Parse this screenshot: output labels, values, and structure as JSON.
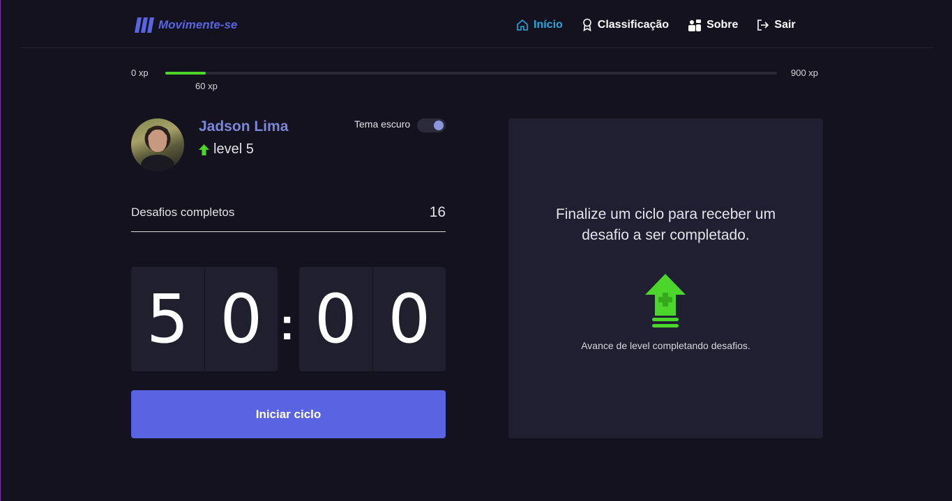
{
  "header": {
    "logo_text": "Movimente-se",
    "nav": [
      {
        "label": "Início",
        "icon": "home-icon",
        "active": true
      },
      {
        "label": "Classificação",
        "icon": "award-icon",
        "active": false
      },
      {
        "label": "Sobre",
        "icon": "people-icon",
        "active": false
      },
      {
        "label": "Sair",
        "icon": "logout-icon",
        "active": false
      }
    ]
  },
  "experience": {
    "min_label": "0 xp",
    "max_label": "900 xp",
    "current_label": "60 xp",
    "current": 60,
    "max": 900
  },
  "profile": {
    "name": "Jadson Lima",
    "level_label": "level 5",
    "theme_label": "Tema escuro",
    "dark_theme_on": true
  },
  "challenges": {
    "label": "Desafios completos",
    "count": "16"
  },
  "countdown": {
    "minute_left": "5",
    "minute_right": "0",
    "separator": ":",
    "second_left": "0",
    "second_right": "0"
  },
  "start_button_label": "Iniciar ciclo",
  "challenge_panel": {
    "title": "Finalize um ciclo para receber um desafio a ser completado.",
    "description": "Avance de level completando desafios.",
    "icon": "level-up-icon"
  },
  "colors": {
    "background": "#13121e",
    "accent": "#5965e0",
    "active_nav": "#2aa9e0",
    "xp_green": "#4cd62b",
    "panel": "#201f32"
  }
}
